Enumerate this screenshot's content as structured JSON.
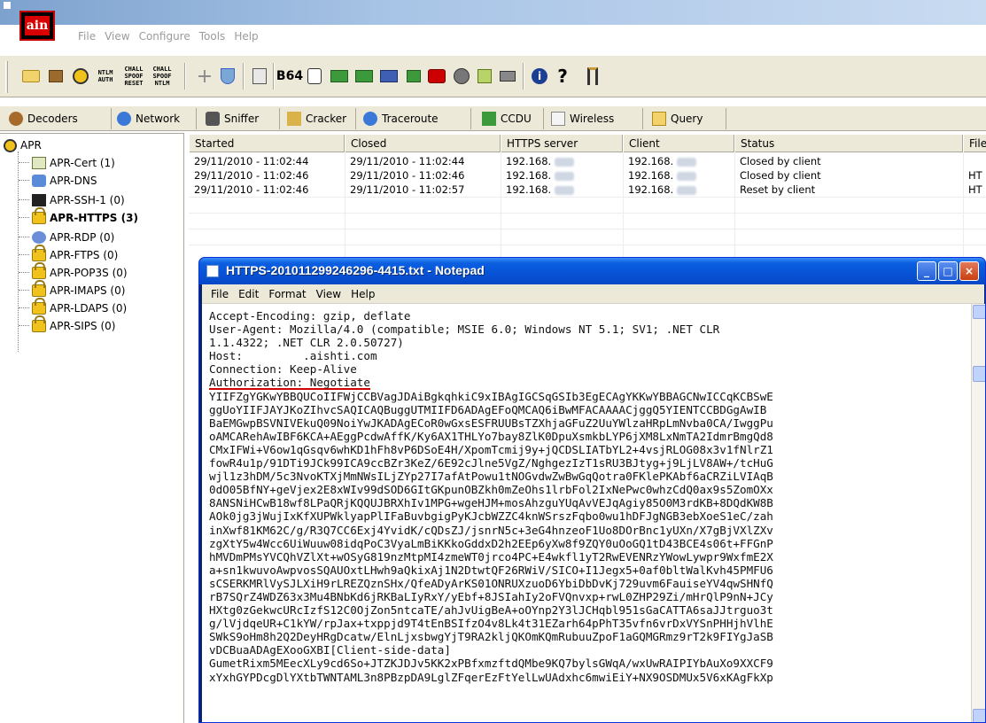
{
  "app": {
    "logo_text": "ain"
  },
  "menubar": {
    "items": [
      "File",
      "View",
      "Configure",
      "Tools",
      "Help"
    ]
  },
  "toolbar": {
    "ntlm_auth": [
      "NTLM",
      "AUTH"
    ],
    "chall_spoof_reset": [
      "CHALL",
      "SPOOF",
      "RESET"
    ],
    "chall_spoof_ntlm": [
      "CHALL",
      "SPOOF",
      "NTLM"
    ],
    "b64_label": "B64"
  },
  "tabs": [
    {
      "label": "Decoders",
      "icon": "decoders-icon"
    },
    {
      "label": "Network",
      "icon": "network-icon"
    },
    {
      "label": "Sniffer",
      "icon": "sniffer-icon"
    },
    {
      "label": "Cracker",
      "icon": "cracker-icon"
    },
    {
      "label": "Traceroute",
      "icon": "traceroute-icon"
    },
    {
      "label": "CCDU",
      "icon": "ccdu-icon"
    },
    {
      "label": "Wireless",
      "icon": "wireless-icon"
    },
    {
      "label": "Query",
      "icon": "query-icon"
    }
  ],
  "tree": {
    "root": "APR",
    "items": [
      {
        "label": "APR-Cert (1)",
        "icon": "cert-icon"
      },
      {
        "label": "APR-DNS",
        "icon": "dns-icon"
      },
      {
        "label": "APR-SSH-1 (0)",
        "icon": "ssh-icon"
      },
      {
        "label": "APR-HTTPS (3)",
        "icon": "lock-icon",
        "selected": true
      },
      {
        "label": "APR-RDP (0)",
        "icon": "rdp-icon"
      },
      {
        "label": "APR-FTPS (0)",
        "icon": "lock-icon"
      },
      {
        "label": "APR-POP3S (0)",
        "icon": "lock-icon"
      },
      {
        "label": "APR-IMAPS (0)",
        "icon": "lock-icon"
      },
      {
        "label": "APR-LDAPS (0)",
        "icon": "lock-icon"
      },
      {
        "label": "APR-SIPS (0)",
        "icon": "lock-icon"
      }
    ]
  },
  "grid": {
    "columns": [
      "Started",
      "Closed",
      "HTTPS server",
      "Client",
      "Status",
      "File"
    ],
    "rows": [
      [
        "29/11/2010 - 11:02:44",
        "29/11/2010 - 11:02:44",
        "192.168.",
        "192.168.",
        "Closed by client",
        ""
      ],
      [
        "29/11/2010 - 11:02:46",
        "29/11/2010 - 11:02:46",
        "192.168.",
        "192.168.",
        "Closed by client",
        "HT"
      ],
      [
        "29/11/2010 - 11:02:46",
        "29/11/2010 - 11:02:57",
        "192.168.",
        "192.168.",
        "Reset by client",
        "HT"
      ]
    ]
  },
  "notepad": {
    "title": "HTTPS-201011299246296-4415.txt - Notepad",
    "menu": [
      "File",
      "Edit",
      "Format",
      "View",
      "Help"
    ],
    "lines": [
      "Accept-Encoding: gzip, deflate",
      "User-Agent: Mozilla/4.0 (compatible; MSIE 6.0; Windows NT 5.1; SV1; .NET CLR",
      "1.1.4322; .NET CLR 2.0.50727)",
      "Host:         .aishti.com",
      "Connection: Keep-Alive",
      "Authorization: Negotiate",
      "YIIFZgYGKwYBBQUCoIIFWjCCBVagJDAiBgkqhkiC9xIBAgIGCSqGSIb3EgECAgYKKwYBBAGCNwICCqKCBSwE",
      "ggUoYIIFJAYJKoZIhvcSAQICAQBuggUTMIIFD6ADAgEFoQMCAQ6iBwMFACAAAACjggQ5YIENTCCBDGgAwIB",
      "BaEMGwpBSVNIVEkuQ09NoiYwJKADAgECoR0wGxsESFRUUBsTZXhjaGFuZ2UuYWlzaHRpLmNvba0CA/IwggPu",
      "oAMCARehAwIBF6KCA+AEggPcdwAffK/Ky6AX1THLYo7bay8ZlK0DpuXsmkbLYP6jXM8LxNmTA2IdmrBmgQd8",
      "CMxIFWi+V6ow1qGsqv6whKD1hFh8vP6DSoE4H/XpomTcmij9y+jQCDSLIATbYL2+4vsjRLOG08x3v1fNlrZ1",
      "fowR4u1p/91DTi9JCk99ICA9ccBZr3KeZ/6E92cJlne5VgZ/NghgezIzT1sRU3BJtyg+j9LjLV8AW+/tcHuG",
      "wjl1z3hDM/5c3NvoKTXjMmNWsILjZYp27I7afAtPowu1tNOGvdwZwBwGqQotra0FKlePKAbf6aCRZiLVIAqB",
      "0dO05BfNY+geVjex2E8xWIv99dSOD6GItGKpunOBZkh0mZeOhs1lrbFol2IxNePwc0whzCdQ0ax9s5ZomOXx",
      "8ANSNiHCwB18wf8LPaQRjKQQUJBRXhIv1MPG+wgeHJM+mosAhzguYUqAvVEJqAgiy85O0M3rdKB+8DQdKW8B",
      "AOk0jg3jWujIxKfXUPWklyapPlIFaBuvbgigPyKJcbWZZC4knWSrszFqbo0wu1hDFJgNGB3ebXoeS1eC/zah",
      "inXwf81KM62C/g/R3Q7CC6Exj4YvidK/cQDsZJ/jsnrN5c+3eG4hnzeoF1Uo8DOrBnc1yUXn/X7gBjVXlZXv",
      "zgXtY5w4Wcc6UiWuuw08idqPoC3VyaLmBiKKkoGddxD2h2EEp6yXw8f9ZQY0uOoGQ1tD43BCE4s06t+FFGnP",
      "hMVDmPMsYVCQhVZlXt+wOSyG819nzMtpMI4zmeWT0jrco4PC+E4wkfl1yT2RwEVENRzYWowLywpr9WxfmE2X",
      "a+sn1kwuvoAwpvosSQAUOxtLHwh9aQkixAj1N2DtwtQF26RWiV/SICO+I1Jegx5+0af0bltWalKvh45PMFU6",
      "sCSERKMRlVySJLXiH9rLREZQznSHx/QfeADyArKS01ONRUXzuoD6YbiDbDvKj729uvm6FauiseYV4qwSHNfQ",
      "rB7SQrZ4WDZ63x3Mu4BNbKd6jRKBaLIyRxY/yEbf+8JSIahIy2oFVQnvxp+rwL0ZHP29Zi/mHrQlP9nN+JCy",
      "HXtg0zGekwcURcIzfS12C0OjZon5ntcaTE/ahJvUigBeA+oOYnp2Y3lJCHqbl951sGaCATTA6saJJtrguo3t",
      "g/lVjdqeUR+C1kYW/rpJax+txppjd9T4tEnBSIfzO4v8Lk4t31EZarh64pPhT35vfn6vrDxVYSnPHHjhVlhE",
      "SWkS9oHm8h2Q2DeyHRgDcatw/ElnLjxsbwgYjT9RA2kljQKOmKQmRubuuZpoF1aGQMGRmz9rT2k9FIYgJaSB",
      "vDCBuaADAgEXooGXBI[Client-side-data]",
      "GumetRixm5MEecXLy9cd6So+JTZKJDJv5KK2xPBfxmzftdQMbe9KQ7bylsGWqA/wxUwRAIPIYbAuXo9XXCF9",
      "xYxhGYPDcgDlYXtbTWNTAML3n8PBzpDA9LglZFqerEzFtYelLwUAdxhc6mwiEiY+NX9OSDMUx5V6xKAgFkXp"
    ],
    "underlined_line_index": 5
  }
}
